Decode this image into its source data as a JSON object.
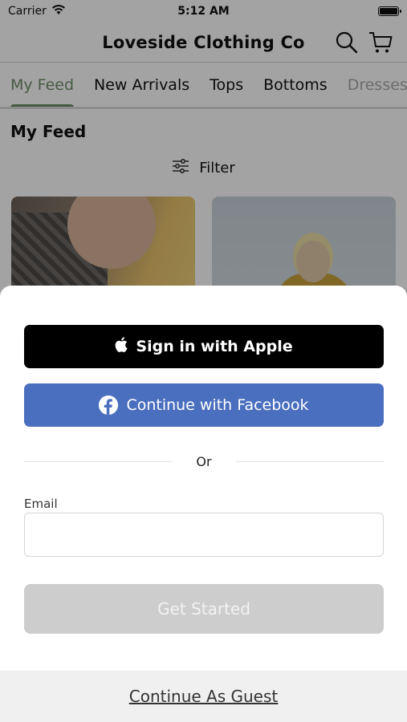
{
  "status_bar": {
    "carrier": "Carrier",
    "time": "5:12 AM"
  },
  "header": {
    "title": "Loveside Clothing Co",
    "icons": [
      "search-icon",
      "cart-icon"
    ]
  },
  "tabs": [
    {
      "label": "My Feed",
      "active": true
    },
    {
      "label": "New Arrivals"
    },
    {
      "label": "Tops"
    },
    {
      "label": "Bottoms"
    },
    {
      "label": "Dresses"
    }
  ],
  "feed": {
    "title": "My Feed",
    "filter_label": "Filter"
  },
  "sheet": {
    "apple_label": "Sign in with Apple",
    "facebook_label": "Continue with Facebook",
    "or_label": "Or",
    "email_label": "Email",
    "email_value": "",
    "email_placeholder": "",
    "get_started_label": "Get Started",
    "guest_label": "Continue As Guest"
  },
  "colors": {
    "accent": "#6f8f6a",
    "facebook": "#4a6fbf",
    "disabled_button": "#cdcdcd"
  }
}
